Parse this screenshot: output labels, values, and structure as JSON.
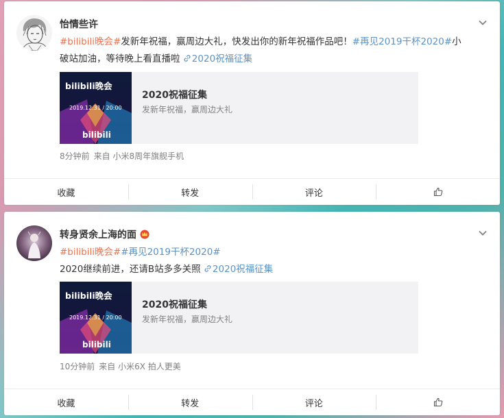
{
  "colors": {
    "tag": "#eb7350",
    "topic": "#5a93c8",
    "meta": "#808080"
  },
  "actions": {
    "favorite": "收藏",
    "forward": "转发",
    "comment": "评论",
    "like_icon": "thumbs-up-icon"
  },
  "posts": [
    {
      "user": "怡情些许",
      "line1": {
        "tag": "#bilibili晚会#",
        "text": "发新年祝福，赢周边大礼，快发出你的新年祝福作品吧！",
        "topic": "#再见2019干杯2020#",
        "tail": "小"
      },
      "line2": {
        "text": "破站加油，等待晚上看直播啦",
        "link": "2020祝福征集"
      },
      "media": {
        "title": "2020祝福征集",
        "sub": "发新年祝福，赢周边大礼",
        "thumb_title": "bilibili晚会",
        "thumb_date": "2019.12.31 / 20:00",
        "thumb_logo": "bilibili"
      },
      "time": "8分钟前",
      "source": "来自 小米8周年旗舰手机"
    },
    {
      "user": "转身贤余上海的面",
      "line1": {
        "tag": "#bilibili晚会#",
        "topic": "#再见2019干杯2020#"
      },
      "line2": {
        "text": "2020继续前进，还请B站多多关照",
        "link": "2020祝福征集"
      },
      "media": {
        "title": "2020祝福征集",
        "sub": "发新年祝福，赢周边大礼",
        "thumb_title": "bilibili晚会",
        "thumb_date": "2019.12.31 / 20:00",
        "thumb_logo": "bilibili"
      },
      "time": "10分钟前",
      "source": "来自 小米6X 拍人更美"
    }
  ]
}
